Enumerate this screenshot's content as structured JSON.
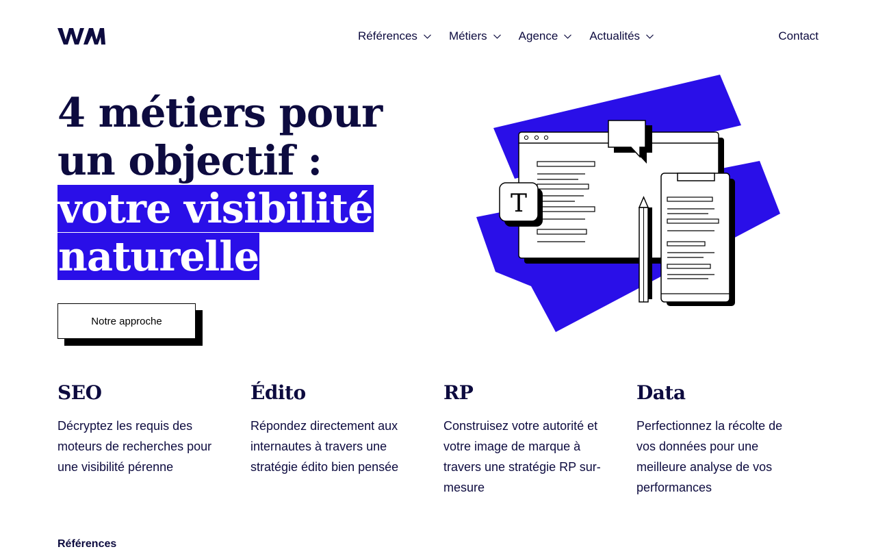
{
  "logo": {
    "name": "wam-logo-icon"
  },
  "nav": {
    "items": [
      {
        "label": "Références"
      },
      {
        "label": "Métiers"
      },
      {
        "label": "Agence"
      },
      {
        "label": "Actualités"
      }
    ],
    "contact": "Contact"
  },
  "hero": {
    "line1": "4 métiers pour",
    "line2": "un objectif :",
    "highlight1": "votre visibilité",
    "highlight2": "naturelle",
    "cta": "Notre approche"
  },
  "illustration": {
    "icons": [
      "browser-window-icon",
      "speech-bubble-icon",
      "text-t-icon",
      "pencil-icon",
      "clipboard-icon"
    ],
    "letter": "T"
  },
  "services": [
    {
      "title": "SEO",
      "desc": "Décryptez les requis des moteurs de recherches pour une visibilité pérenne"
    },
    {
      "title": "Édito",
      "desc": "Répondez directement aux internautes à travers une stratégie édito bien pensée"
    },
    {
      "title": "RP",
      "desc": "Construisez votre autorité et votre image de marque à travers une stratégie RP sur-mesure"
    },
    {
      "title": "Data",
      "desc": "Perfectionnez la récolte de vos données pour une meilleure analyse de vos performances"
    }
  ],
  "references_label": "Références",
  "colors": {
    "accent": "#2a0fe8",
    "text": "#0d0b3f",
    "background": "#ffffff"
  }
}
